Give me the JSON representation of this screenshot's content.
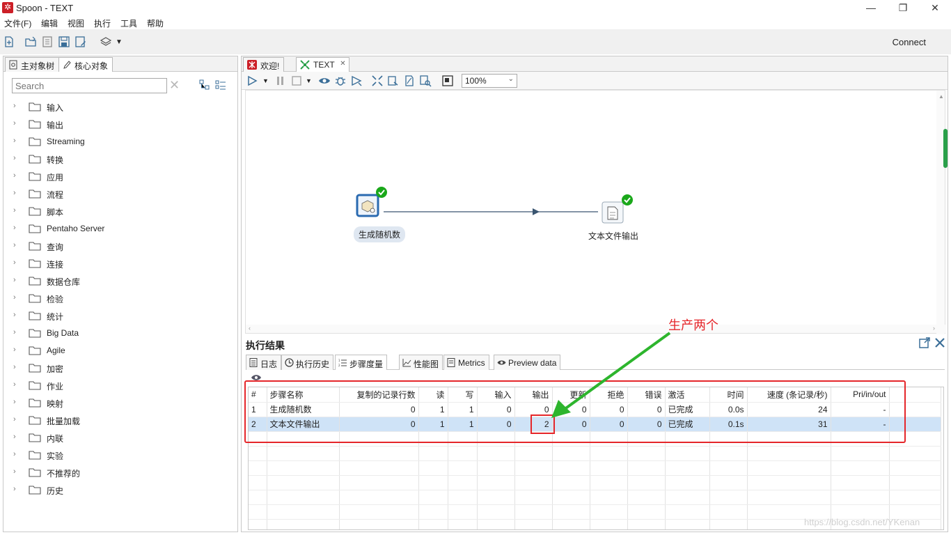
{
  "window": {
    "title": "Spoon - TEXT",
    "minimize": "—",
    "restore": "❐",
    "close": "✕"
  },
  "menu": [
    "文件(F)",
    "编辑",
    "视图",
    "执行",
    "工具",
    "帮助"
  ],
  "toolbar": {
    "connect_label": "Connect"
  },
  "left_panel": {
    "tabs": [
      "主对象树",
      "核心对象"
    ],
    "search_placeholder": "Search",
    "tree_items": [
      "输入",
      "输出",
      "Streaming",
      "转换",
      "应用",
      "流程",
      "脚本",
      "Pentaho Server",
      "查询",
      "连接",
      "数据仓库",
      "检验",
      "统计",
      "Big Data",
      "Agile",
      "加密",
      "作业",
      "映射",
      "批量加载",
      "内联",
      "实验",
      "不推荐的",
      "历史"
    ]
  },
  "doc_tabs": [
    {
      "label": "欢迎!"
    },
    {
      "label": "TEXT",
      "close": "✕"
    }
  ],
  "zoom": "100%",
  "canvas": {
    "steps": [
      {
        "label": "生成随机数",
        "status": "success"
      },
      {
        "label": "文本文件输出",
        "status": "success"
      }
    ]
  },
  "results": {
    "title": "执行结果",
    "tabs": [
      "日志",
      "执行历史",
      "步骤度量",
      "性能图",
      "Metrics",
      "Preview data"
    ],
    "columns": [
      "#",
      "步骤名称",
      "复制的记录行数",
      "读",
      "写",
      "输入",
      "输出",
      "更新",
      "拒绝",
      "错误",
      "激活",
      "时间",
      "速度 (条记录/秒)",
      "Pri/in/out"
    ],
    "rows": [
      [
        "1",
        "生成随机数",
        "0",
        "1",
        "1",
        "0",
        "0",
        "0",
        "0",
        "0",
        "已完成",
        "0.0s",
        "24",
        "-"
      ],
      [
        "2",
        "文本文件输出",
        "0",
        "1",
        "1",
        "0",
        "2",
        "0",
        "0",
        "0",
        "已完成",
        "0.1s",
        "31",
        "-"
      ]
    ]
  },
  "annotation": {
    "text": "生产两个"
  },
  "watermark": "https://blog.csdn.net/YKenan",
  "colors": {
    "annotation": "#e5262a",
    "arrow": "#2db52d",
    "selection": "#cfe3f7",
    "success": "#1aa81a",
    "step_border": "#2a6ab0"
  }
}
